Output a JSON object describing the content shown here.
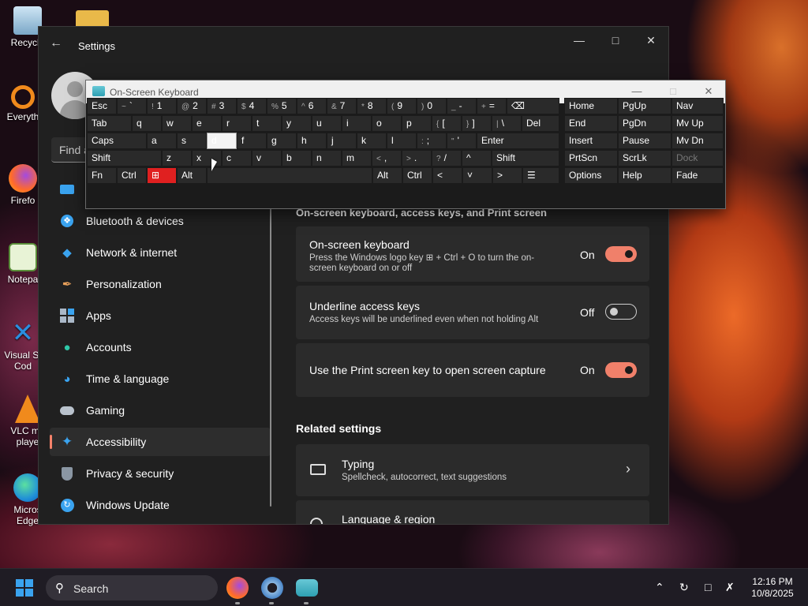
{
  "desktop": {
    "icons": [
      {
        "label": "Recycle",
        "icon": "recycle-bin-icon"
      },
      {
        "label": "Everyth",
        "icon": "everything-search-icon"
      },
      {
        "label": "Firefo",
        "icon": "firefox-icon"
      },
      {
        "label": "Notepa",
        "icon": "notepad-icon"
      },
      {
        "label": "Visual St",
        "label2": "Cod",
        "icon": "vscode-icon"
      },
      {
        "label": "VLC me",
        "label2": "playe",
        "icon": "vlc-icon"
      },
      {
        "label": "Micros",
        "label2": "Edge",
        "icon": "edge-icon"
      }
    ]
  },
  "settings": {
    "title": "Settings",
    "find_placeholder": "Find a",
    "nav": [
      {
        "label": "Bluetooth & devices",
        "icon": "bluetooth-icon"
      },
      {
        "label": "Network & internet",
        "icon": "wifi-icon"
      },
      {
        "label": "Personalization",
        "icon": "brush-icon"
      },
      {
        "label": "Apps",
        "icon": "apps-icon"
      },
      {
        "label": "Accounts",
        "icon": "accounts-icon"
      },
      {
        "label": "Time & language",
        "icon": "globe-clock-icon"
      },
      {
        "label": "Gaming",
        "icon": "gamepad-icon"
      },
      {
        "label": "Accessibility",
        "icon": "accessibility-icon",
        "active": true
      },
      {
        "label": "Privacy & security",
        "icon": "shield-icon"
      },
      {
        "label": "Windows Update",
        "icon": "update-icon"
      }
    ],
    "section_title": "On-screen keyboard, access keys, and Print screen",
    "cards": [
      {
        "title": "On-screen keyboard",
        "desc": "Press the Windows logo key ⊞ + Ctrl + O to turn the on-screen keyboard on or off",
        "state": "On",
        "on": true
      },
      {
        "title": "Underline access keys",
        "desc": "Access keys will be underlined even when not holding Alt",
        "state": "Off",
        "on": false
      },
      {
        "title": "Use the Print screen key to open screen capture",
        "desc": "",
        "state": "On",
        "on": true
      }
    ],
    "related_title": "Related settings",
    "related": [
      {
        "title": "Typing",
        "desc": "Spellcheck, autocorrect, text suggestions",
        "icon": "keyboard-icon"
      },
      {
        "title": "Language & region",
        "icon": "language-icon"
      }
    ]
  },
  "osk": {
    "title": "On-Screen Keyboard",
    "rows": [
      [
        {
          "label": "Esc"
        },
        {
          "sub": "~",
          "label": "`"
        },
        {
          "sub": "!",
          "label": "1"
        },
        {
          "sub": "@",
          "label": "2"
        },
        {
          "sub": "#",
          "label": "3"
        },
        {
          "sub": "$",
          "label": "4"
        },
        {
          "sub": "%",
          "label": "5"
        },
        {
          "sub": "^",
          "label": "6"
        },
        {
          "sub": "&",
          "label": "7"
        },
        {
          "sub": "*",
          "label": "8"
        },
        {
          "sub": "(",
          "label": "9"
        },
        {
          "sub": ")",
          "label": "0"
        },
        {
          "sub": "_",
          "label": "-"
        },
        {
          "sub": "+",
          "label": "="
        },
        {
          "label": "⌫"
        }
      ],
      [
        {
          "label": "Tab"
        },
        {
          "label": "q"
        },
        {
          "label": "w"
        },
        {
          "label": "e"
        },
        {
          "label": "r"
        },
        {
          "label": "t"
        },
        {
          "label": "y"
        },
        {
          "label": "u"
        },
        {
          "label": "i"
        },
        {
          "label": "o"
        },
        {
          "label": "p"
        },
        {
          "sub": "{",
          "label": "["
        },
        {
          "sub": "}",
          "label": "]"
        },
        {
          "sub": "|",
          "label": "\\"
        },
        {
          "label": "Del"
        }
      ],
      [
        {
          "label": "Caps"
        },
        {
          "label": "a"
        },
        {
          "label": "s"
        },
        {
          "label": "d"
        },
        {
          "label": "f"
        },
        {
          "label": "g"
        },
        {
          "label": "h"
        },
        {
          "label": "j"
        },
        {
          "label": "k"
        },
        {
          "label": "l"
        },
        {
          "sub": ":",
          "label": ";"
        },
        {
          "sub": "\"",
          "label": "'"
        },
        {
          "label": "Enter"
        }
      ],
      [
        {
          "label": "Shift"
        },
        {
          "label": "z"
        },
        {
          "label": "x"
        },
        {
          "label": "c"
        },
        {
          "label": "v"
        },
        {
          "label": "b"
        },
        {
          "label": "n"
        },
        {
          "label": "m"
        },
        {
          "sub": "<",
          "label": ","
        },
        {
          "sub": ">",
          "label": "."
        },
        {
          "sub": "?",
          "label": "/"
        },
        {
          "label": "^"
        },
        {
          "label": "Shift"
        }
      ],
      [
        {
          "label": "Fn"
        },
        {
          "label": "Ctrl"
        },
        {
          "label": "⊞"
        },
        {
          "label": "Alt"
        },
        {
          "label": ""
        },
        {
          "label": "Alt"
        },
        {
          "label": "Ctrl"
        },
        {
          "label": "<"
        },
        {
          "label": "˅"
        },
        {
          "label": ">"
        },
        {
          "label": "☰"
        }
      ]
    ],
    "nav_keys": [
      [
        "Home",
        "PgUp",
        "Nav"
      ],
      [
        "End",
        "PgDn",
        "Mv Up"
      ],
      [
        "Insert",
        "Pause",
        "Mv Dn"
      ],
      [
        "PrtScn",
        "ScrLk",
        "Dock"
      ],
      [
        "Options",
        "Help",
        "Fade"
      ]
    ]
  },
  "taskbar": {
    "search_label": "Search",
    "apps": [
      "firefox-icon",
      "settings-icon",
      "osk-icon"
    ],
    "time": "12:16 PM",
    "date": "10/8/2025"
  },
  "colors": {
    "accent": "#f0806a",
    "win_key": "#e02020",
    "windows_blue": "#3aa3ef"
  }
}
